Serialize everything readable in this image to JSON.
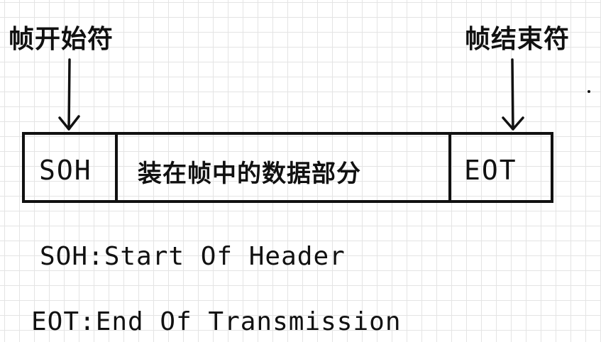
{
  "diagram": {
    "start_label": "帧开始符",
    "end_label": "帧结束符",
    "frame": {
      "soh": "SOH",
      "payload": "装在帧中的数据部分",
      "eot": "EOT"
    },
    "legend": {
      "soh_line": "SOH:Start Of Header",
      "eot_line": "EOT:End Of Transmission"
    }
  }
}
